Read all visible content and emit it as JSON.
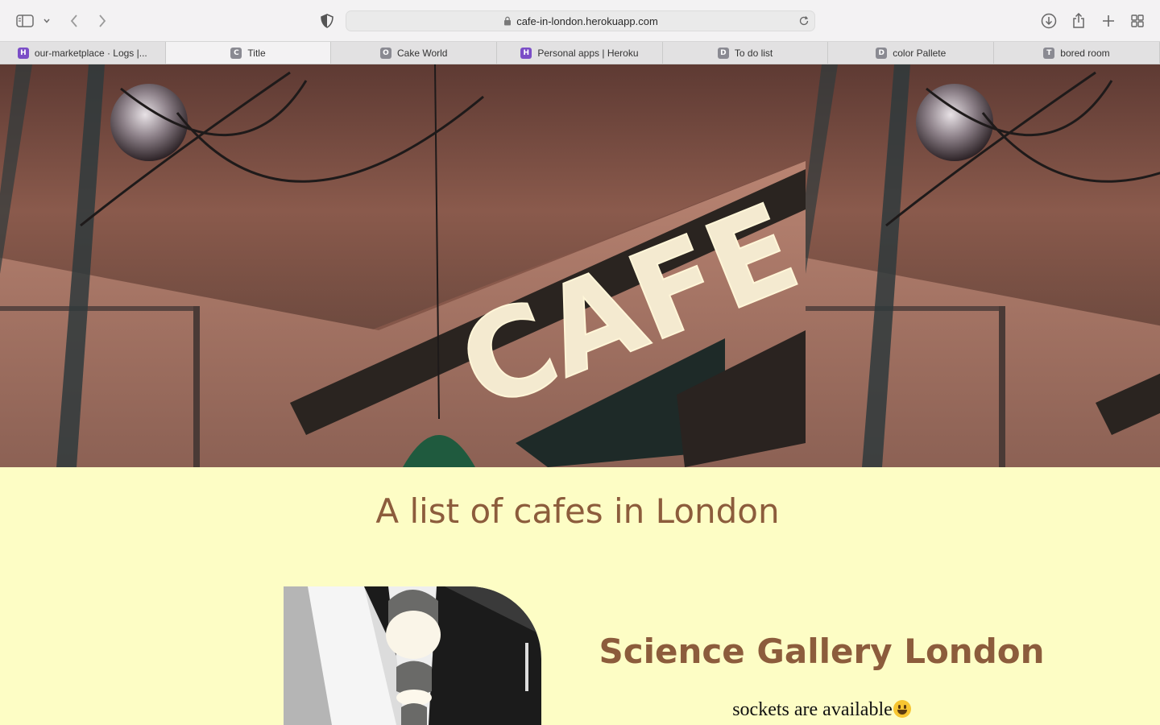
{
  "browser": {
    "url": "cafe-in-london.herokuapp.com",
    "tabs": [
      {
        "label": "our-marketplace · Logs |...",
        "favicon": "H",
        "color": "#7b4ec7",
        "active": false
      },
      {
        "label": "Title",
        "favicon": "C",
        "color": "#8a8a92",
        "active": true
      },
      {
        "label": "Cake World",
        "favicon": "O",
        "color": "#8a8a92",
        "active": false
      },
      {
        "label": "Personal apps | Heroku",
        "favicon": "H",
        "color": "#7b4ec7",
        "active": false
      },
      {
        "label": "To do list",
        "favicon": "D",
        "color": "#8a8a92",
        "active": false
      },
      {
        "label": "color Pallete",
        "favicon": "D",
        "color": "#8a8a92",
        "active": false
      },
      {
        "label": "bored room",
        "favicon": "T",
        "color": "#8a8a92",
        "active": false
      }
    ]
  },
  "page": {
    "hero_sign": "CAFE",
    "heading": "A list of cafes in London",
    "cafes": [
      {
        "name": "Science Gallery London",
        "info": "sockets are available"
      }
    ],
    "colors": {
      "background": "#fdfdc5",
      "heading": "#8c5c3c"
    }
  }
}
